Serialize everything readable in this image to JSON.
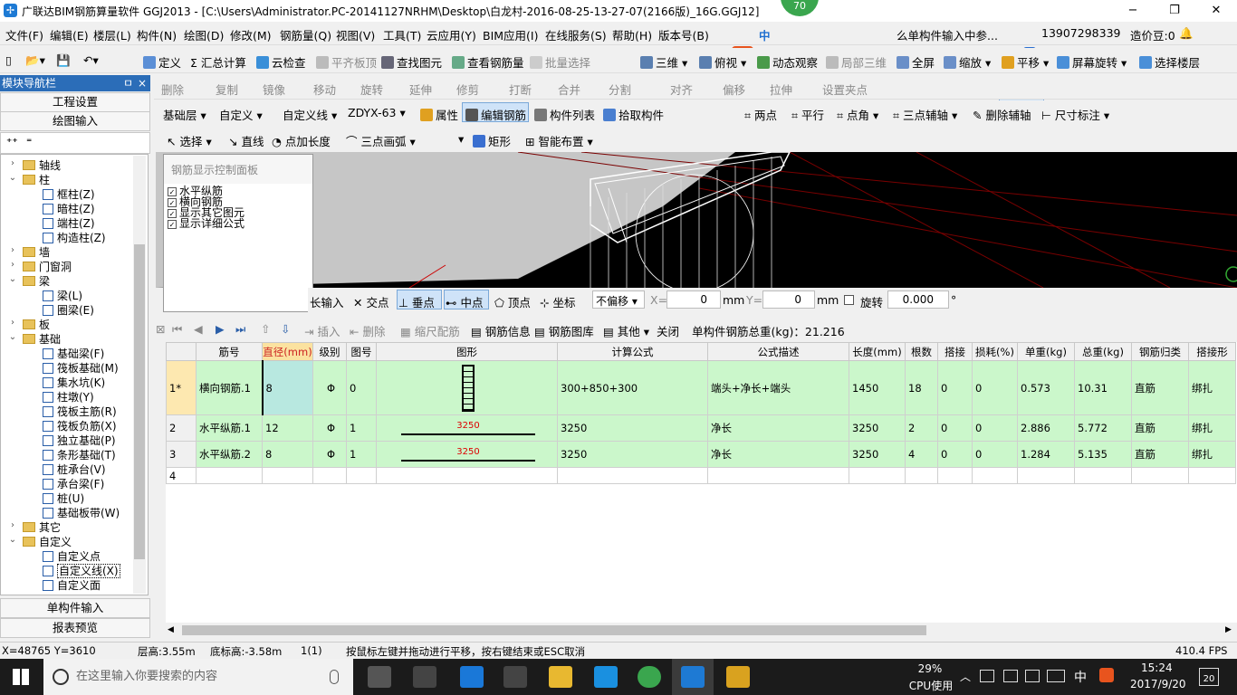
{
  "window": {
    "title": "广联达BIM钢筋算量软件 GGJ2013 - [C:\\Users\\Administrator.PC-20141127NRHM\\Desktop\\白龙村-2016-08-25-13-27-07(2166版)_16G.GGJ12]",
    "badge": "70",
    "min": "−",
    "max": "❐",
    "close": "✕"
  },
  "menu": [
    "文件(F)",
    "编辑(E)",
    "楼层(L)",
    "构件(N)",
    "绘图(D)",
    "修改(M)",
    "钢筋量(Q)",
    "视图(V)",
    "工具(T)",
    "云应用(Y)",
    "BIM应用(I)",
    "在线服务(S)",
    "帮助(H)",
    "版本号(B)"
  ],
  "menu_right": {
    "ime_cn": "中",
    "search_hint": "么单构件输入中参...",
    "phone": "13907298339",
    "cost": "造价豆:0"
  },
  "toolbar1": [
    "定义",
    "Σ 汇总计算",
    "云检查",
    "平齐板顶",
    "查找图元",
    "查看钢筋量",
    "批量选择",
    "三维",
    "俯视",
    "动态观察",
    "局部三维",
    "全屏",
    "缩放",
    "平移",
    "屏幕旋转",
    "选择楼层"
  ],
  "toolbar2": [
    "删除",
    "复制",
    "镜像",
    "移动",
    "旋转",
    "延伸",
    "修剪",
    "打断",
    "合并",
    "分割",
    "对齐",
    "偏移",
    "拉伸",
    "设置夹点"
  ],
  "toolbar3": {
    "layer": "基础层",
    "type": "自定义",
    "subtype": "自定义线",
    "code": "ZDYX-63",
    "attr": "属性",
    "edit_rebar": "编辑钢筋",
    "list": "构件列表",
    "pick": "拾取构件",
    "two_point": "两点",
    "parallel": "平行",
    "point_angle": "点角",
    "three_point_axis": "三点辅轴",
    "del_axis": "删除辅轴",
    "dim": "尺寸标注"
  },
  "toolbar4": {
    "select": "选择",
    "line": "直线",
    "point_len": "点加长度",
    "arc": "三点画弧",
    "rect": "矩形",
    "smart": "智能布置"
  },
  "nav": {
    "header": "模块导航栏",
    "pin": "ㅁ",
    "close": "×",
    "btn1": "工程设置",
    "btn2": "绘图输入",
    "btn3": "单构件输入",
    "btn4": "报表预览"
  },
  "tree": [
    {
      "label": "轴线",
      "level": 1,
      "exp": "›",
      "type": "folder"
    },
    {
      "label": "柱",
      "level": 1,
      "exp": "⌄",
      "type": "folder"
    },
    {
      "label": "框柱(Z)",
      "level": 2,
      "type": "node"
    },
    {
      "label": "暗柱(Z)",
      "level": 2,
      "type": "node"
    },
    {
      "label": "端柱(Z)",
      "level": 2,
      "type": "node"
    },
    {
      "label": "构造柱(Z)",
      "level": 2,
      "type": "node"
    },
    {
      "label": "墙",
      "level": 1,
      "exp": "›",
      "type": "folder"
    },
    {
      "label": "门窗洞",
      "level": 1,
      "exp": "›",
      "type": "folder"
    },
    {
      "label": "梁",
      "level": 1,
      "exp": "⌄",
      "type": "folder"
    },
    {
      "label": "梁(L)",
      "level": 2,
      "type": "node"
    },
    {
      "label": "圈梁(E)",
      "level": 2,
      "type": "node"
    },
    {
      "label": "板",
      "level": 1,
      "exp": "›",
      "type": "folder"
    },
    {
      "label": "基础",
      "level": 1,
      "exp": "⌄",
      "type": "folder"
    },
    {
      "label": "基础梁(F)",
      "level": 2,
      "type": "node"
    },
    {
      "label": "筏板基础(M)",
      "level": 2,
      "type": "node"
    },
    {
      "label": "集水坑(K)",
      "level": 2,
      "type": "node"
    },
    {
      "label": "柱墩(Y)",
      "level": 2,
      "type": "node"
    },
    {
      "label": "筏板主筋(R)",
      "level": 2,
      "type": "node"
    },
    {
      "label": "筏板负筋(X)",
      "level": 2,
      "type": "node"
    },
    {
      "label": "独立基础(P)",
      "level": 2,
      "type": "node"
    },
    {
      "label": "条形基础(T)",
      "level": 2,
      "type": "node"
    },
    {
      "label": "桩承台(V)",
      "level": 2,
      "type": "node"
    },
    {
      "label": "承台梁(F)",
      "level": 2,
      "type": "node"
    },
    {
      "label": "桩(U)",
      "level": 2,
      "type": "node"
    },
    {
      "label": "基础板带(W)",
      "level": 2,
      "type": "node"
    },
    {
      "label": "其它",
      "level": 1,
      "exp": "›",
      "type": "folder"
    },
    {
      "label": "自定义",
      "level": 1,
      "exp": "⌄",
      "type": "folder"
    },
    {
      "label": "自定义点",
      "level": 2,
      "type": "node"
    },
    {
      "label": "自定义线(X)",
      "level": 2,
      "type": "node",
      "selected": true
    },
    {
      "label": "自定义面",
      "level": 2,
      "type": "node"
    }
  ],
  "panel": {
    "title": "钢筋显示控制面板",
    "items": [
      "水平纵筋",
      "横向钢筋",
      "显示其它图元",
      "显示详细公式"
    ]
  },
  "snapbar": {
    "input": "长输入",
    "intersect": "交点",
    "perp": "垂点",
    "mid": "中点",
    "vertex": "顶点",
    "coord": "坐标",
    "offset_mode": "不偏移",
    "x_label": "X=",
    "x_val": "0",
    "mm1": "mm",
    "y_label": "Y=",
    "y_val": "0",
    "mm2": "mm",
    "rotate": "旋转",
    "rotate_val": "0.000",
    "deg": "°"
  },
  "gridbar": {
    "insert": "插入",
    "delete": "删除",
    "scale": "缩尺配筋",
    "info": "钢筋信息",
    "lib": "钢筋图库",
    "other": "其他",
    "close": "关闭",
    "total": "单构件钢筋总重(kg)：21.216"
  },
  "table": {
    "headers": [
      "筋号",
      "直径(mm)",
      "级别",
      "图号",
      "图形",
      "计算公式",
      "公式描述",
      "长度(mm)",
      "根数",
      "搭接",
      "损耗(%)",
      "单重(kg)",
      "总重(kg)",
      "钢筋归类",
      "搭接形"
    ],
    "rows": [
      {
        "no": "1*",
        "name": "横向钢筋.1",
        "dia": "8",
        "grade": "Φ",
        "fig": "0",
        "shape": "",
        "formula": "300+850+300",
        "desc": "端头+净长+端头",
        "len": "1450",
        "count": "18",
        "lap": "0",
        "loss": "0",
        "unit": "0.573",
        "total": "10.31",
        "cat": "直筋",
        "laptype": "绑扎"
      },
      {
        "no": "2",
        "name": "水平纵筋.1",
        "dia": "12",
        "grade": "Φ",
        "fig": "1",
        "shape": "3250",
        "formula": "3250",
        "desc": "净长",
        "len": "3250",
        "count": "2",
        "lap": "0",
        "loss": "0",
        "unit": "2.886",
        "total": "5.772",
        "cat": "直筋",
        "laptype": "绑扎"
      },
      {
        "no": "3",
        "name": "水平纵筋.2",
        "dia": "8",
        "grade": "Φ",
        "fig": "1",
        "shape": "3250",
        "formula": "3250",
        "desc": "净长",
        "len": "3250",
        "count": "4",
        "lap": "0",
        "loss": "0",
        "unit": "1.284",
        "total": "5.135",
        "cat": "直筋",
        "laptype": "绑扎"
      },
      {
        "no": "4",
        "name": "",
        "dia": "",
        "grade": "",
        "fig": "",
        "shape": "",
        "formula": "",
        "desc": "",
        "len": "",
        "count": "",
        "lap": "",
        "loss": "",
        "unit": "",
        "total": "",
        "cat": "",
        "laptype": ""
      }
    ]
  },
  "status": {
    "coords": "X=48765 Y=3610",
    "floor_h": "层高:3.55m",
    "bottom_h": "底标高:-3.58m",
    "count": "1(1)",
    "hint": "按鼠标左键并拖动进行平移，按右键结束或ESC取消",
    "fps": "410.4 FPS"
  },
  "taskbar": {
    "search": "在这里输入你要搜索的内容",
    "cpu_pct": "29%",
    "cpu_label": "CPU使用",
    "ime": "中",
    "time": "15:24",
    "date": "2017/9/20",
    "notif": "20"
  },
  "colors": {
    "selected_row": "#cbf7cb",
    "nav_header": "#2b6db8",
    "canvas": "#000000"
  }
}
